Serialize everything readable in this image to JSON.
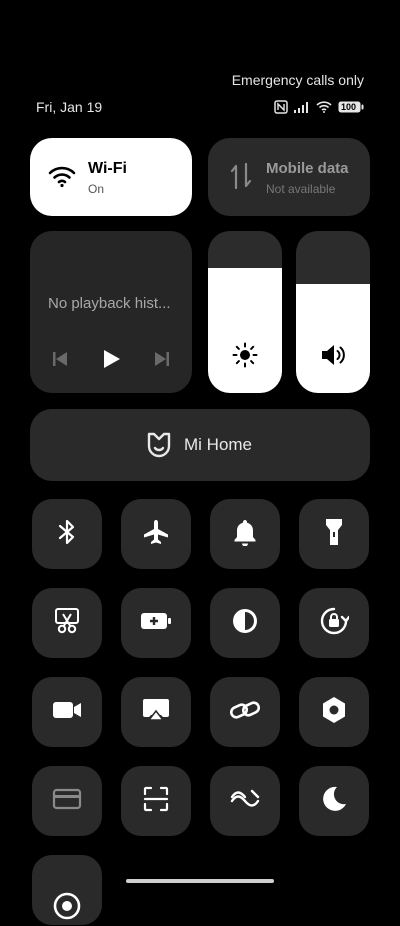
{
  "status": {
    "emergency": "Emergency calls only",
    "date": "Fri, Jan 19",
    "battery": "100"
  },
  "wifi": {
    "title": "Wi-Fi",
    "sub": "On"
  },
  "mobile_data": {
    "title": "Mobile data",
    "sub": "Not available"
  },
  "media": {
    "message": "No playback hist..."
  },
  "brightness": {
    "level": 0.77
  },
  "volume": {
    "level": 0.67
  },
  "mi_home": {
    "label": "Mi Home"
  }
}
